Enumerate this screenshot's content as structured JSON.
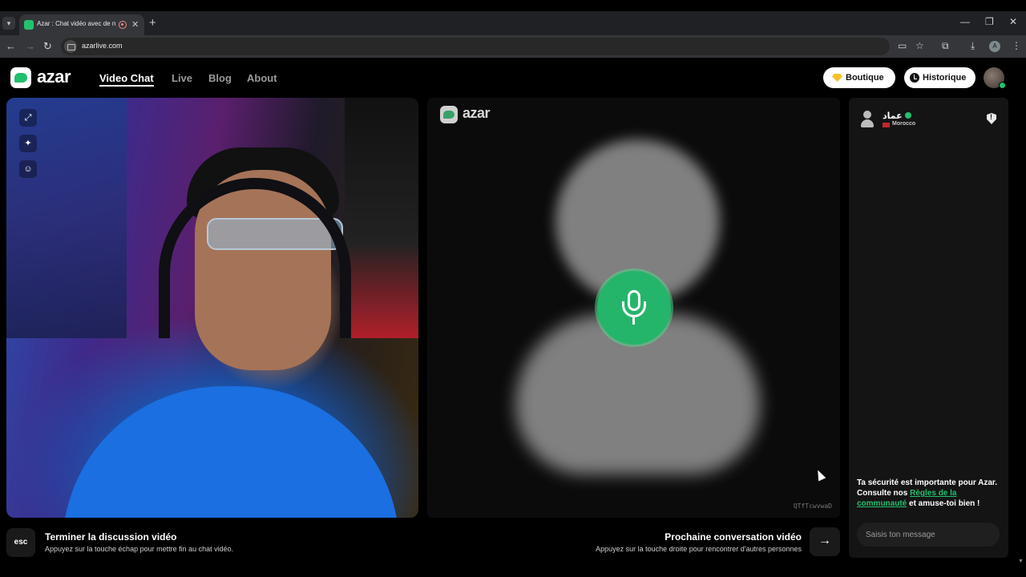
{
  "browser": {
    "tab_title": "Azar : Chat vidéo avec de n",
    "url": "azarlive.com",
    "profile_letter": "A",
    "icons": {
      "tab_list": "chevron-down-icon",
      "tab_close": "close-icon",
      "new_tab": "plus-icon",
      "back": "arrow-left-icon",
      "forward": "arrow-right-icon",
      "reload": "reload-icon",
      "cast": "cast-icon",
      "bookmark": "star-icon",
      "extensions": "puzzle-icon",
      "download": "download-icon",
      "menu": "kebab-icon"
    }
  },
  "header": {
    "logo_text": "azar",
    "nav": [
      {
        "label": "Video Chat",
        "active": true
      },
      {
        "label": "Live",
        "active": false
      },
      {
        "label": "Blog",
        "active": false
      },
      {
        "label": "About",
        "active": false
      }
    ],
    "shop_label": "Boutique",
    "history_label": "Historique"
  },
  "local_video": {
    "tools": [
      "expand-icon",
      "magic-wand-icon",
      "sticker-icon"
    ]
  },
  "remote_video": {
    "logo_text": "azar",
    "session_id": "QTfTcwvwaD"
  },
  "bottom": {
    "esc_key": "esc",
    "end_title": "Terminer la discussion vidéo",
    "end_sub": "Appuyez sur la touche échap pour mettre fin au chat vidéo.",
    "next_title": "Prochaine conversation vidéo",
    "next_sub": "Appuyez sur la touche droite pour rencontrer d'autres personnes",
    "next_icon": "→"
  },
  "chat": {
    "partner_name": "عماد",
    "partner_country": "Morocco",
    "safety_prefix": "Ta sécurité est importante pour Azar. Consulte nos ",
    "safety_link": "Règles de la communauté",
    "safety_suffix": " et amuse-toi bien !",
    "input_placeholder": "Saisis ton message"
  },
  "colors": {
    "brand_green": "#21c06c",
    "background": "#000000",
    "chat_panel": "#141414"
  }
}
